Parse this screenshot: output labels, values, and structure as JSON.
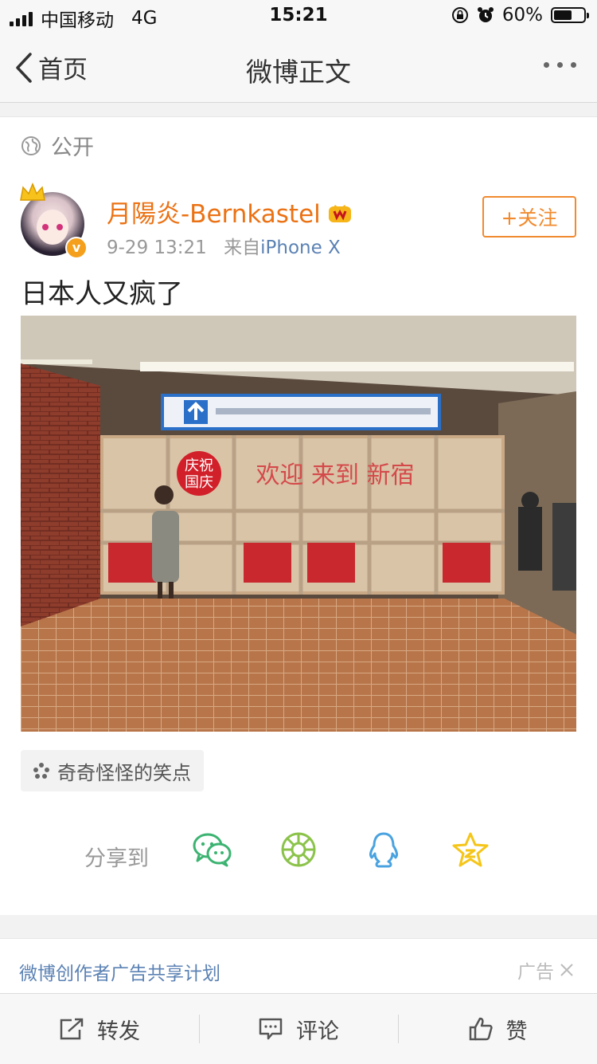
{
  "status_bar": {
    "carrier": "中国移动",
    "network": "4G",
    "time": "15:21",
    "battery": "60%",
    "battery_level": 0.6
  },
  "nav": {
    "back_label": "首页",
    "title": "微博正文"
  },
  "visibility": {
    "label": "公开"
  },
  "post": {
    "username": "月陽炎-Bernkastel",
    "time": "9-29 13:21",
    "source_prefix": "来自",
    "source": "iPhone X",
    "follow_label": "+关注",
    "text": "日本人又疯了",
    "photo_texts": {
      "banner_left": "庆祝",
      "banner_left2": "国庆",
      "welcome": "欢迎 来到 新宿"
    },
    "tag": "奇奇怪怪的笑点"
  },
  "share": {
    "label": "分享到",
    "targets": [
      "wechat-icon",
      "moments-icon",
      "qq-icon",
      "qzone-icon"
    ]
  },
  "ad": {
    "text": "微博创作者广告共享计划",
    "label": "广告"
  },
  "toolbar": {
    "repost": "转发",
    "comment": "评论",
    "like": "赞"
  },
  "colors": {
    "accent_orange": "#eb7214",
    "link_blue": "#5b82b4",
    "wechat_green": "#3cb371",
    "moments_green": "#8bc34a",
    "qq_blue": "#4aa3e0",
    "qzone_yellow": "#f5c518"
  }
}
